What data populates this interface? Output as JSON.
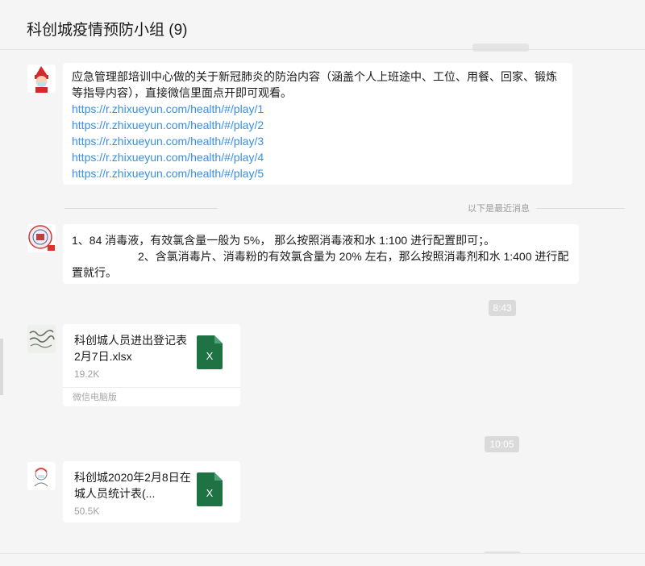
{
  "header": {
    "title": "科创城疫情预防小组 (9)"
  },
  "messages": {
    "m1": {
      "text": "应急管理部培训中心做的关于新冠肺炎的防治内容（涵盖个人上班途中、工位、用餐、回家、锻炼等指导内容），直接微信里面点开即可观看。",
      "links": [
        "https://r.zhixueyun.com/health/#/play/1",
        "https://r.zhixueyun.com/health/#/play/2",
        "https://r.zhixueyun.com/health/#/play/3",
        "https://r.zhixueyun.com/health/#/play/4",
        "https://r.zhixueyun.com/health/#/play/5"
      ]
    },
    "divider_text": "以下是最近消息",
    "m2": {
      "line1": "1、84 消毒液，有效氯含量一般为 5%，  那么按照消毒液和水 1:100 进行配置即可；。",
      "line2": "2、含氯消毒片、消毒粉的有效氯含量为 20% 左右，那么按照消毒剂和水 1:400 进行配置就行。"
    },
    "time1": "8:43",
    "file1": {
      "name": "科创城人员进出登记表2月7日.xlsx",
      "size": "19.2K",
      "source": "微信电脑版"
    },
    "time2": "10:05",
    "file2": {
      "name": "科创城2020年2月8日在城人员统计表(...",
      "size": "50.5K"
    }
  },
  "icons": {
    "file_type": "xlsx-icon",
    "file_letter": "X"
  },
  "colors": {
    "link": "#3a8ee6",
    "excel": "#1f7244",
    "background": "#f5f5f5"
  }
}
